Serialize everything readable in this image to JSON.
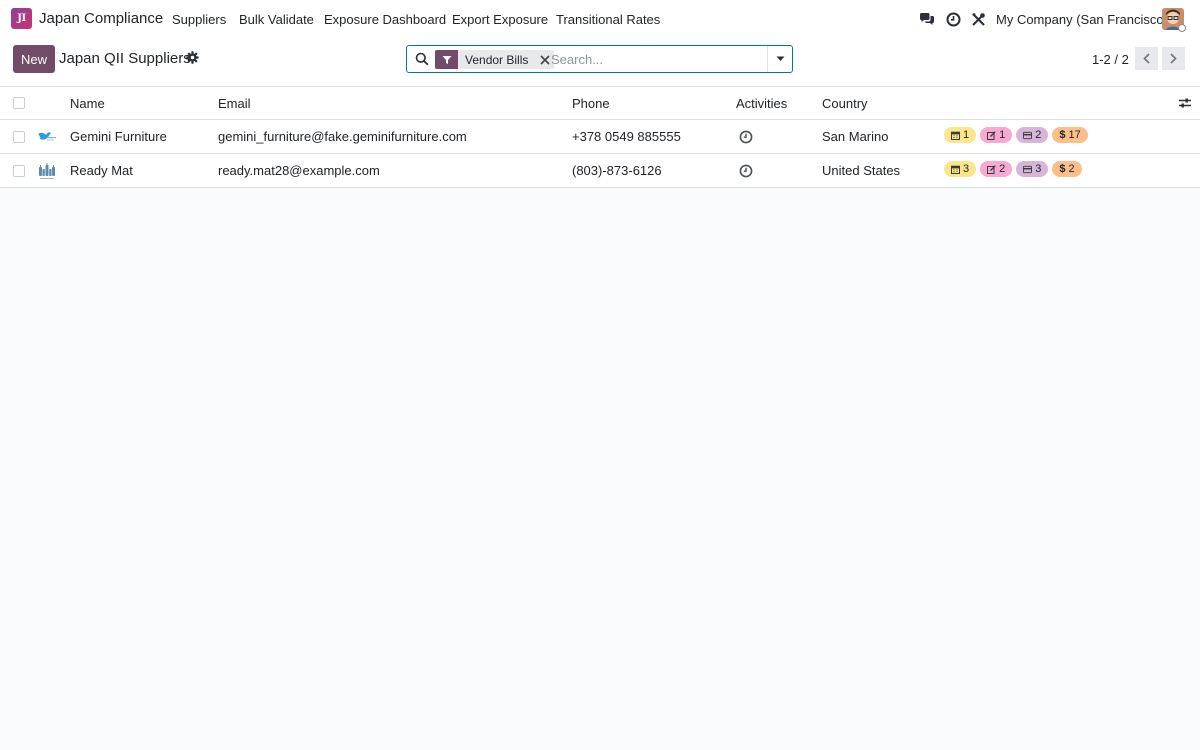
{
  "navbar": {
    "logo_text": "JI",
    "app_name": "Japan Compliance",
    "menu": [
      {
        "label": "Suppliers"
      },
      {
        "label": "Bulk Validate"
      },
      {
        "label": "Exposure Dashboard"
      },
      {
        "label": "Export Exposure"
      },
      {
        "label": "Transitional Rates"
      }
    ],
    "icons": [
      "chat-icon",
      "clock-icon",
      "tools-icon"
    ],
    "company": "My Company (San Francisco)"
  },
  "control": {
    "new_label": "New",
    "title": "Japan QII Suppliers",
    "search": {
      "facet_label": "Vendor Bills",
      "placeholder": "Search..."
    },
    "pager": "1-2 / 2"
  },
  "table": {
    "columns": [
      "Name",
      "Email",
      "Phone",
      "Activities",
      "Country"
    ],
    "rows": [
      {
        "name": "Gemini Furniture",
        "email": "gemini_furniture@fake.geminifurniture.com",
        "phone": "+378 0549 885555",
        "country": "San Marino",
        "badges": {
          "calendar": "1",
          "edit": "1",
          "card": "2",
          "dollar": "17"
        }
      },
      {
        "name": "Ready Mat",
        "email": "ready.mat28@example.com",
        "phone": "(803)-873-6126",
        "country": "United States",
        "badges": {
          "calendar": "3",
          "edit": "2",
          "card": "3",
          "dollar": "2"
        }
      }
    ]
  },
  "colors": {
    "brand": "#714b67",
    "search_border": "#017e84",
    "badge_calendar": "#fde68a",
    "badge_edit": "#f9a8d4",
    "badge_card": "#d8b4d8",
    "badge_dollar": "#fbbf8a"
  }
}
